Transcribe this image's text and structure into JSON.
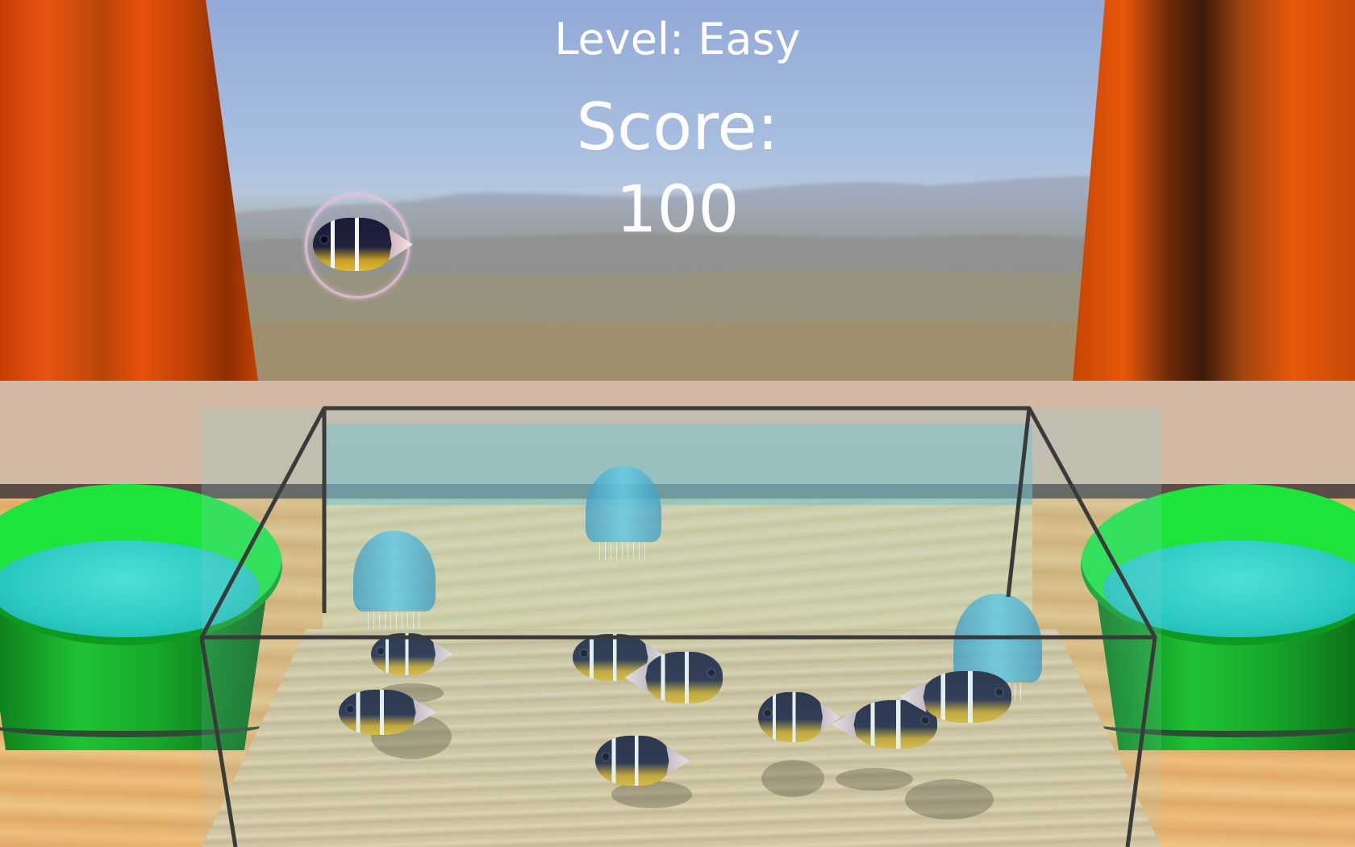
{
  "hud": {
    "level_text": "Level: Easy",
    "score_label": "Score:",
    "score_value": "100"
  },
  "scene": {
    "fish_icon": "clownfish",
    "jellyfish_icon": "jellyfish",
    "bucket_icon": "bucket",
    "colors": {
      "curtain": "#e55410",
      "bucket": "#1ce43a",
      "water": "#2bc9c2",
      "tank_frame": "#3a3a3a"
    }
  }
}
